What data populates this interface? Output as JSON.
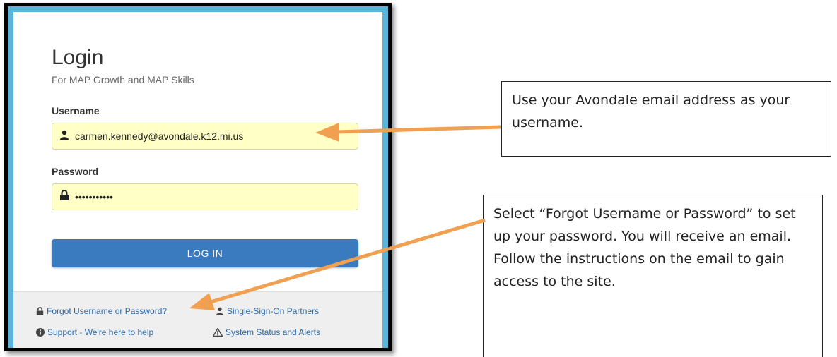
{
  "login": {
    "title": "Login",
    "subtitle": "For MAP Growth and MAP Skills",
    "username_label": "Username",
    "username_value": "carmen.kennedy@avondale.k12.mi.us",
    "password_label": "Password",
    "password_value": "•••••••••••",
    "login_button": "LOG IN"
  },
  "footer": {
    "forgot": "Forgot Username or Password?",
    "sso": "Single-Sign-On Partners",
    "support": "Support - We're here to help",
    "status": "System Status and Alerts"
  },
  "callouts": {
    "username_tip": "Use your Avondale email address as your username.",
    "forgot_tip": "Select “Forgot Username or Password” to set up your password. You will receive an email.  Follow the instructions on the email to gain access to the site."
  },
  "colors": {
    "accent": "#3a7abf",
    "field_bg": "#ffffc6",
    "frame_blue": "#5ab3d9",
    "arrow": "#f0a050",
    "link": "#2a6aaa"
  },
  "icons": [
    "user-icon",
    "lock-icon",
    "info-icon",
    "warning-icon"
  ]
}
